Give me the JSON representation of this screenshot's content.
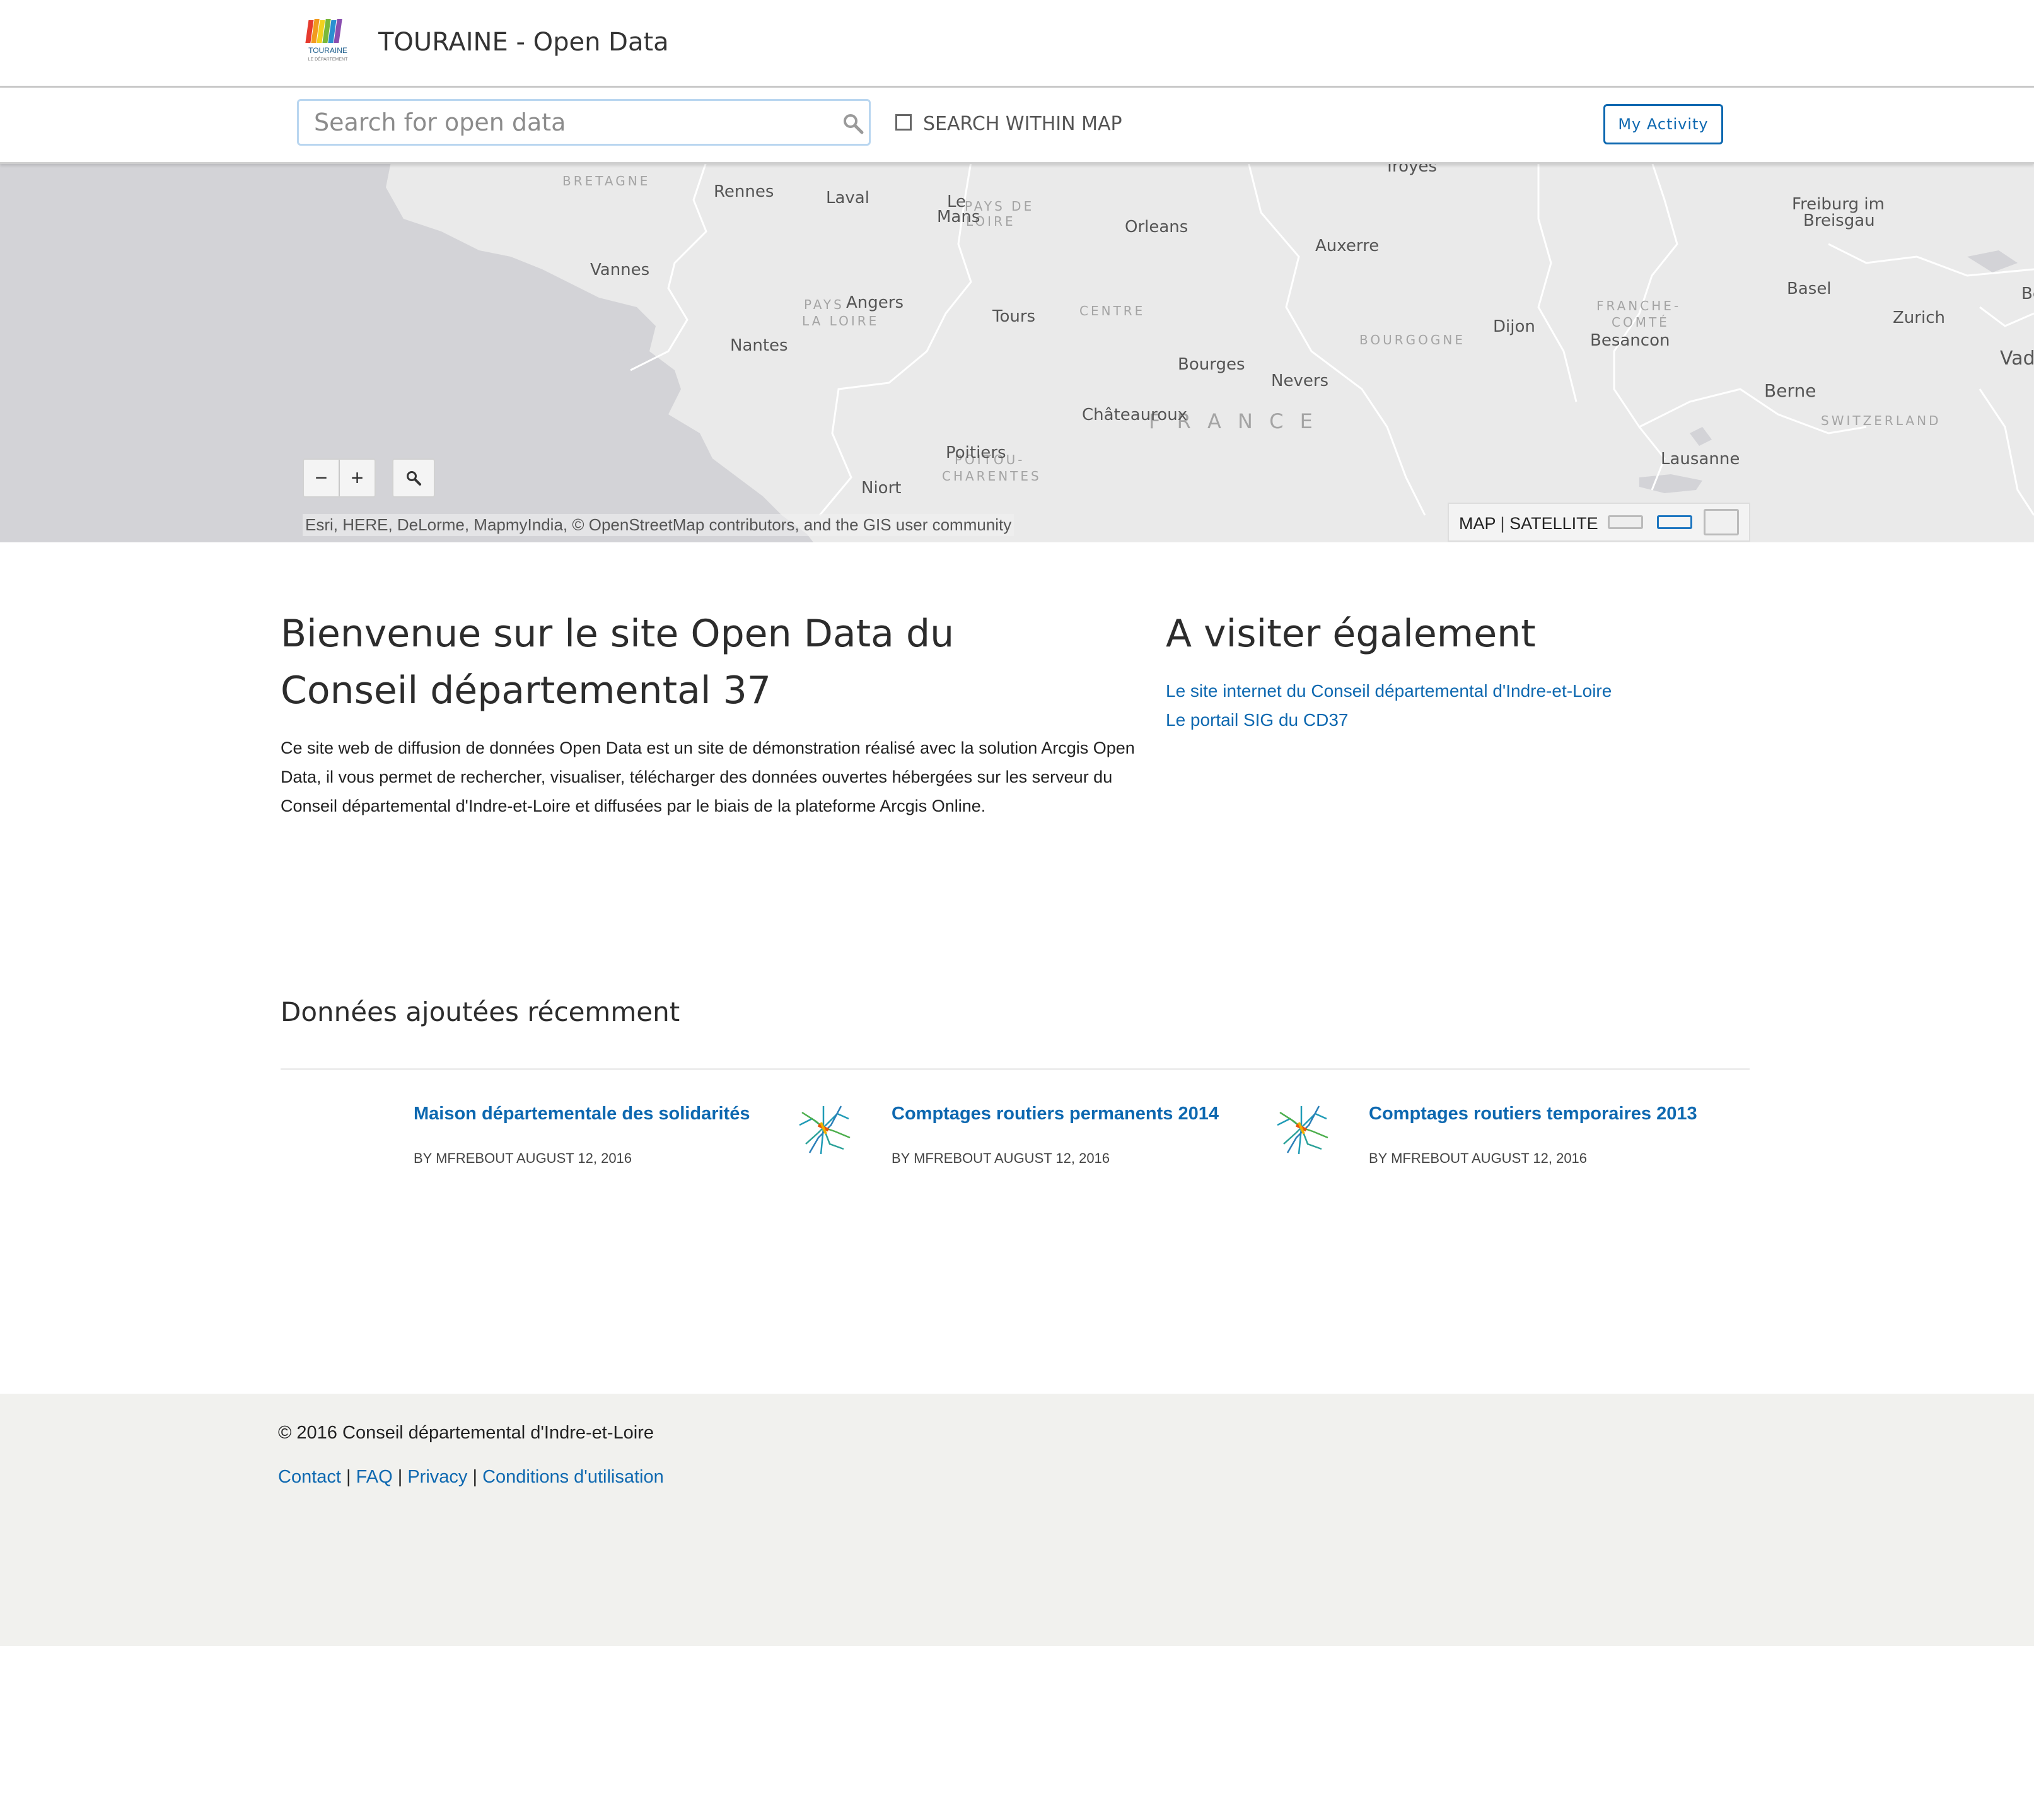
{
  "header": {
    "site_title": "TOURAINE - Open Data",
    "logo_text": "TOURAINE",
    "logo_subtext": "LE DÉPARTEMENT"
  },
  "search": {
    "placeholder": "Search for open data",
    "within_map_label": "SEARCH WITHIN MAP",
    "within_map_checked": false,
    "activity_button": "My Activity"
  },
  "map": {
    "cities": [
      "Rennes",
      "Laval",
      "Le",
      "Mans",
      "Orleans",
      "Troyes",
      "Auxerre",
      "Freiburg im",
      "Breisgau",
      "Vannes",
      "Angers",
      "Tours",
      "Nantes",
      "Dijon",
      "Besancon",
      "Basel",
      "Zurich",
      "Bourges",
      "Nevers",
      "Châteauroux",
      "Berne",
      "Poitiers",
      "Niort",
      "Lausanne",
      "Vad",
      "Be"
    ],
    "regions": [
      "BRETAGNE",
      "PAYS DE",
      "LOIRE",
      "PAYS",
      "LA LOIRE",
      "CENTRE",
      "BOURGOGNE",
      "FRANCHE-",
      "COMTÉ",
      "F R A N C E",
      "SWITZERLAND",
      "POITOU-",
      "CHARENTES"
    ],
    "zoom_out": "−",
    "zoom_in": "+",
    "attribution": "Esri, HERE, DeLorme, MapmyIndia, © OpenStreetMap contributors, and the GIS user community",
    "basemap_map": "MAP",
    "basemap_separator": "|",
    "basemap_satellite": "SATELLITE",
    "colors": {
      "land": "#eaeaea",
      "water": "#d3d3d7",
      "border": "#ffffff"
    }
  },
  "welcome": {
    "title": "Bienvenue sur le site Open Data du Conseil départemental 37",
    "body": "Ce site web de diffusion de données Open Data est un site de démonstration réalisé avec la solution Arcgis Open Data, il vous permet de rechercher, visualiser, télécharger des données ouvertes hébergées sur les serveur du Conseil départemental d'Indre-et-Loire et diffusées par le biais de la plateforme Arcgis Online."
  },
  "also_visit": {
    "title": "A visiter également",
    "links": [
      "Le site internet du Conseil départemental d'Indre-et-Loire",
      "Le portail SIG du CD37"
    ]
  },
  "recent": {
    "title": "Données ajoutées récemment",
    "items": [
      {
        "title": "Maison départementale des solidarités",
        "meta": "BY MFREBOUT AUGUST 12, 2016",
        "thumb": false
      },
      {
        "title": "Comptages routiers permanents 2014",
        "meta": "BY MFREBOUT AUGUST 12, 2016",
        "thumb": true
      },
      {
        "title": "Comptages routiers temporaires 2013",
        "meta": "BY MFREBOUT AUGUST 12, 2016",
        "thumb": true
      }
    ]
  },
  "footer": {
    "copyright": "© 2016 Conseil départemental d'Indre-et-Loire",
    "links": [
      "Contact",
      "FAQ",
      "Privacy",
      "Conditions d'utilisation"
    ],
    "separator": "|"
  }
}
